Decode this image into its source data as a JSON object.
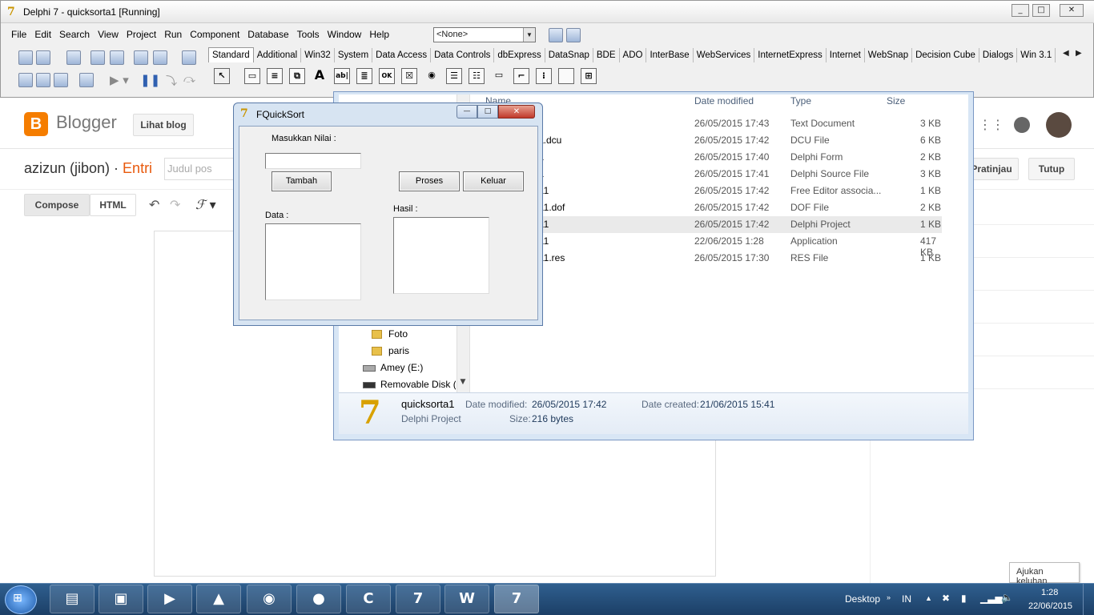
{
  "ide": {
    "title": "Delphi 7 - quicksorta1 [Running]",
    "menu": [
      "File",
      "Edit",
      "Search",
      "View",
      "Project",
      "Run",
      "Component",
      "Database",
      "Tools",
      "Window",
      "Help"
    ],
    "combo_value": "<None>",
    "palette_tabs": [
      "Standard",
      "Additional",
      "Win32",
      "System",
      "Data Access",
      "Data Controls",
      "dbExpress",
      "DataSnap",
      "BDE",
      "ADO",
      "InterBase",
      "WebServices",
      "InternetExpress",
      "Internet",
      "WebSnap",
      "Decision Cube",
      "Dialogs",
      "Win 3.1"
    ]
  },
  "blogger": {
    "brand": "Blogger",
    "view_blog": "Lihat blog",
    "post_title_user": "azizun (jibon) · ",
    "post_title_entry": "Entri",
    "title_placeholder": "Judul pos",
    "compose": "Compose",
    "html": "HTML",
    "preview": "Pratinjau",
    "close": "Tutup"
  },
  "explorer": {
    "columns": {
      "name": "Name",
      "date": "Date modified",
      "type": "Type",
      "size": "Size"
    },
    "files": [
      {
        "name": "",
        "date": "26/05/2015 17:43",
        "type": "Text Document",
        "size": "3 KB"
      },
      {
        "name": "a.dcu",
        "date": "26/05/2015 17:42",
        "type": "DCU File",
        "size": "6 KB"
      },
      {
        "name": "a",
        "date": "26/05/2015 17:40",
        "type": "Delphi Form",
        "size": "2 KB"
      },
      {
        "name": "a",
        "date": "26/05/2015 17:41",
        "type": "Delphi Source File",
        "size": "3 KB"
      },
      {
        "name": "a1",
        "date": "26/05/2015 17:42",
        "type": "Free Editor associa...",
        "size": "1 KB"
      },
      {
        "name": "a1.dof",
        "date": "26/05/2015 17:42",
        "type": "DOF File",
        "size": "2 KB"
      },
      {
        "name": "a1",
        "date": "26/05/2015 17:42",
        "type": "Delphi Project",
        "size": "1 KB"
      },
      {
        "name": "a1",
        "date": "22/06/2015 1:28",
        "type": "Application",
        "size": "417 KB"
      },
      {
        "name": "a1.res",
        "date": "26/05/2015 17:30",
        "type": "RES File",
        "size": "1 KB"
      }
    ],
    "tree": [
      "Foto",
      "paris",
      "Amey (E:)",
      "Removable Disk (I"
    ],
    "details": {
      "name": "quicksorta1",
      "kind": "Delphi Project",
      "modified_label": "Date modified:",
      "modified": "26/05/2015 17:42",
      "created_label": "Date created:",
      "created": "21/06/2015 15:41",
      "size_label": "Size:",
      "size": "216 bytes"
    }
  },
  "form": {
    "title": "FQuickSort",
    "input_label": "Masukkan Nilai :",
    "add_button": "Tambah",
    "process_button": "Proses",
    "exit_button": "Keluar",
    "data_label": "Data :",
    "result_label": "Hasil :"
  },
  "taskbar": {
    "desktop": "Desktop",
    "lang": "IN",
    "time": "1:28",
    "date": "22/06/2015",
    "tooltip": "Ajukan keluhan"
  }
}
